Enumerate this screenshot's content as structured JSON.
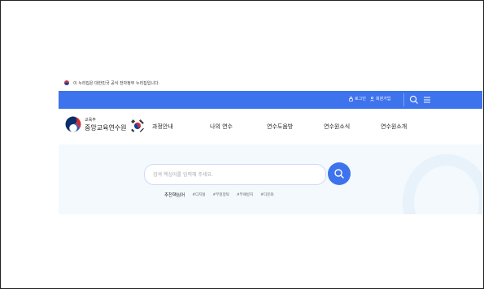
{
  "gov_banner": {
    "flag_icon": "taegukgi-icon",
    "text": "이 누리집은 대한민국 공식 전자정부 누리집입니다."
  },
  "util_bar": {
    "color": "#3d73ed",
    "login_label": "로그인",
    "signup_label": "회원가입",
    "icons": [
      "lock-icon",
      "person-icon",
      "search-icon",
      "menu-icon"
    ]
  },
  "logo": {
    "ministry": "교육부",
    "name": "중앙교육연수원",
    "icon": "government-emblem-icon"
  },
  "nav": {
    "items": [
      "과정안내",
      "나의 연수",
      "연수도움방",
      "연수원소식",
      "연수원소개"
    ]
  },
  "search": {
    "placeholder": "검색 핵심어를 입력해 주세요.",
    "button_icon": "search-icon",
    "recommend_label": "추천핵심어",
    "keywords": [
      "#디지털",
      "#부정청탁",
      "#부패방지",
      "#다문화"
    ]
  }
}
